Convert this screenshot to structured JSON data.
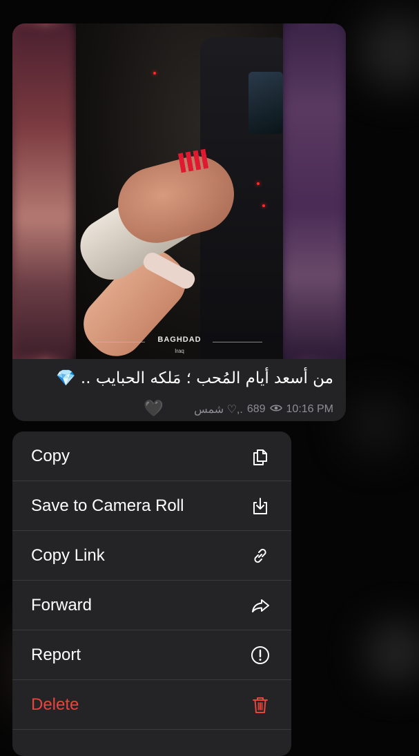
{
  "message": {
    "location": {
      "name": "BAGHDAD",
      "sub": "Iraq"
    },
    "caption": "من أسعد أيام المُحب ؛ مَلكه الحبايب .. 💎",
    "heart": "🖤",
    "author": "شمس ♡,.",
    "views": "689",
    "time": "10:16 PM"
  },
  "context_menu": {
    "items": [
      {
        "label": "Copy",
        "icon": "copy-icon",
        "destructive": false
      },
      {
        "label": "Save to Camera Roll",
        "icon": "save-download-icon",
        "destructive": false
      },
      {
        "label": "Copy Link",
        "icon": "link-icon",
        "destructive": false
      },
      {
        "label": "Forward",
        "icon": "forward-arrow-icon",
        "destructive": false
      },
      {
        "label": "Report",
        "icon": "exclamation-circle-icon",
        "destructive": false
      },
      {
        "label": "Delete",
        "icon": "trash-icon",
        "destructive": true
      }
    ]
  },
  "colors": {
    "menu_background": "#242426",
    "destructive": "#e8453c",
    "bubble_background": "#232325"
  }
}
